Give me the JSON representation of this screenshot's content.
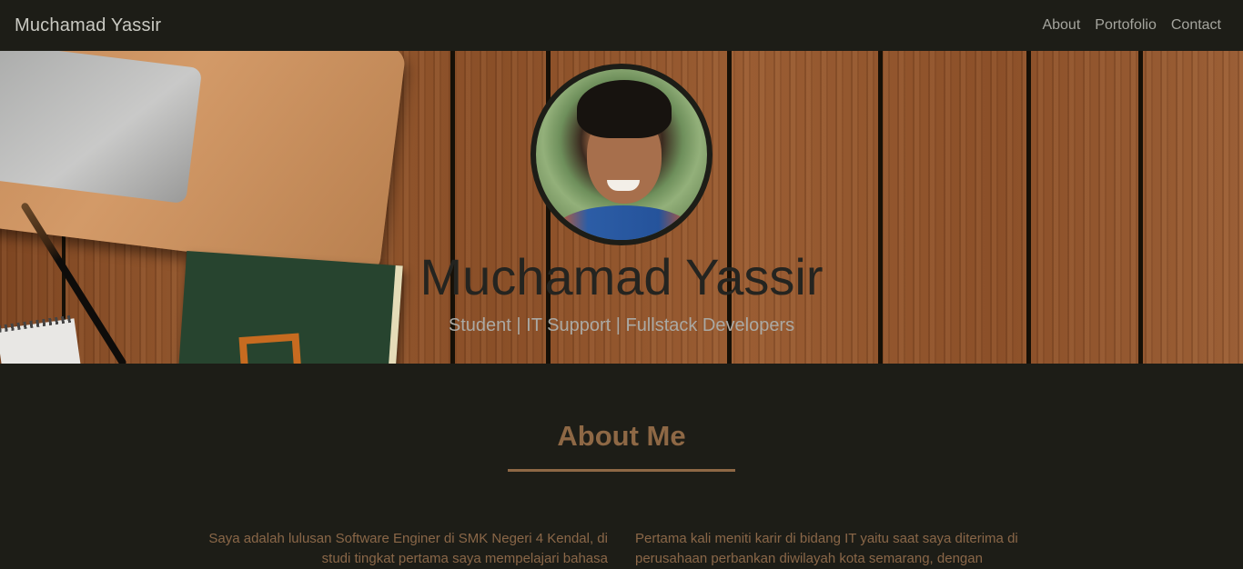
{
  "navbar": {
    "brand": "Muchamad Yassir",
    "links": [
      {
        "label": "About"
      },
      {
        "label": "Portofolio"
      },
      {
        "label": "Contact"
      }
    ]
  },
  "hero": {
    "title": "Muchamad Yassir",
    "subtitle": "Student | IT Support | Fullstack Developers"
  },
  "about": {
    "heading": "About Me",
    "column_left": "Saya adalah lulusan Software Enginer di SMK Negeri 4 Kendal, di studi tingkat pertama saya mempelajari bahasa",
    "column_right": "Pertama kali meniti karir di bidang IT yaitu saat saya diterima di perusahaan perbankan diwilayah kota semarang, dengan"
  },
  "colors": {
    "background": "#1d1d17",
    "accent": "#8e6845",
    "wood": "#8a4e27"
  }
}
